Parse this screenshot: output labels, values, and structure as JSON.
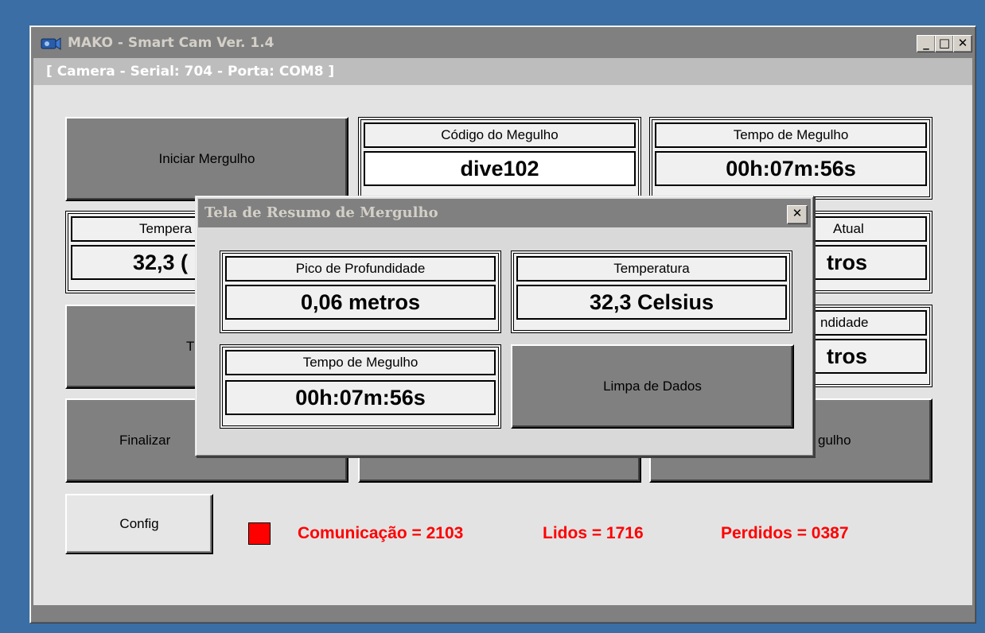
{
  "window": {
    "title": "MAKO - Smart Cam Ver. 1.4",
    "minimize": "_",
    "maximize": "□",
    "close": "✕",
    "icon": "camera-icon"
  },
  "header": {
    "camera_info": "[ Camera - Serial: 704 - Porta: COM8 ]"
  },
  "buttons": {
    "start_dive": "Iniciar Mergulho",
    "finish_dive_partial": "Finalizar",
    "right_bottom_partial": "gulho",
    "middle_left_partial": "T",
    "config": "Config"
  },
  "panels": {
    "dive_code": {
      "label": "Código do Megulho",
      "value": "dive102"
    },
    "dive_time": {
      "label": "Tempo de Megulho",
      "value": "00h:07m:56s"
    },
    "temperature": {
      "label_partial": "Tempera",
      "value_partial": "32,3 ("
    },
    "current_depth": {
      "label_partial": "Atual",
      "value_partial": "tros"
    },
    "peak_depth": {
      "label_partial": "ndidade",
      "value_partial": "tros"
    }
  },
  "status": {
    "indicator_color": "#ff0000",
    "communication": "Comunicação = 2103",
    "read": "Lidos = 1716",
    "lost": "Perdidos = 0387"
  },
  "dialog": {
    "title": "Tela de Resumo de Mergulho",
    "close": "✕",
    "peak_depth": {
      "label": "Pico de Profundidade",
      "value": "0,06 metros"
    },
    "temperature": {
      "label": "Temperatura",
      "value": "32,3 Celsius"
    },
    "dive_time": {
      "label": "Tempo de Megulho",
      "value": "00h:07m:56s"
    },
    "clear_button": "Limpa de Dados"
  }
}
